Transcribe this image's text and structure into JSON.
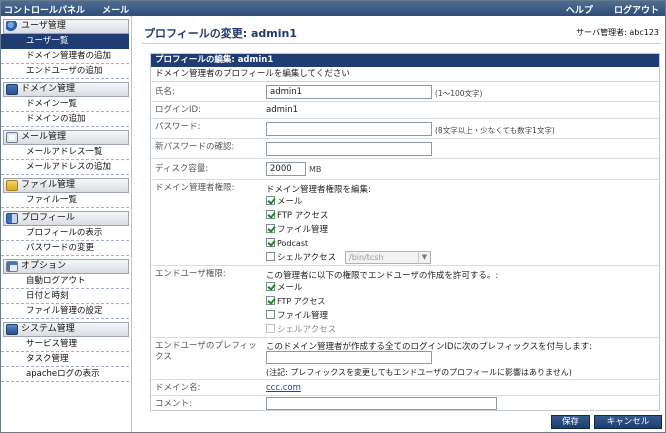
{
  "topbar": {
    "menu": [
      "コントロールパネル",
      "メール"
    ],
    "right": [
      "ヘルプ",
      "ログアウト"
    ]
  },
  "sidebar": {
    "sections": [
      {
        "title": "ユーザ管理",
        "icon": "users-icon",
        "items": [
          "ユーザ一覧",
          "ドメイン管理者の追加",
          "エンドユーザの追加"
        ]
      },
      {
        "title": "ドメイン管理",
        "icon": "network-icon",
        "items": [
          "ドメイン一覧",
          "ドメインの追加"
        ]
      },
      {
        "title": "メール管理",
        "icon": "mail-icon",
        "items": [
          "メールアドレス一覧",
          "メールアドレスの追加"
        ]
      },
      {
        "title": "ファイル管理",
        "icon": "folder-icon",
        "items": [
          "ファイル一覧"
        ]
      },
      {
        "title": "プロフィール",
        "icon": "profile-icon",
        "items": [
          "プロフィールの表示",
          "パスワードの変更"
        ]
      },
      {
        "title": "オプション",
        "icon": "options-icon",
        "items": [
          "自動ログアウト",
          "日付と時刻",
          "ファイル管理の設定"
        ]
      },
      {
        "title": "システム管理",
        "icon": "system-icon",
        "items": [
          "サービス管理",
          "タスク管理",
          "apacheログの表示"
        ]
      }
    ],
    "selected": "ユーザ一覧"
  },
  "header": {
    "title": "プロフィールの変更: admin1",
    "admin_label": "サーバ管理者: abc123"
  },
  "panel": {
    "title": "プロフィールの編集: admin1",
    "description": "ドメイン管理者のプロフィールを編集してください",
    "fields": {
      "name": {
        "label": "氏名:",
        "value": "admin1",
        "note": "(1〜100文字)"
      },
      "login": {
        "label": "ログインID:",
        "value": "admin1"
      },
      "password": {
        "label": "パスワード:",
        "value": "",
        "note": "(8文字以上・少なくても数字1文字)"
      },
      "password_confirm": {
        "label": "新パスワードの確認:",
        "value": ""
      },
      "disk": {
        "label": "ディスク容量:",
        "value": "2000",
        "unit": "MB"
      },
      "domain_perm": {
        "label": "ドメイン管理者権限:",
        "intro": "ドメイン管理者権限を編集:",
        "options": [
          {
            "label": "メール",
            "checked": true
          },
          {
            "label": "FTP アクセス",
            "checked": true
          },
          {
            "label": "ファイル管理",
            "checked": true
          },
          {
            "label": "Podcast",
            "checked": true
          },
          {
            "label": "シェルアクセス",
            "checked": false
          }
        ],
        "shell_select": "/bin/tcsh"
      },
      "enduser_perm": {
        "label": "エンドユーザ権限:",
        "intro": "この管理者に以下の権限でエンドユーザの作成を許可する。:",
        "options": [
          {
            "label": "メール",
            "checked": true
          },
          {
            "label": "FTP アクセス",
            "checked": true
          },
          {
            "label": "ファイル管理",
            "checked": false
          },
          {
            "label": "シェルアクセス",
            "checked": false
          }
        ]
      },
      "prefix": {
        "label": "エンドユーザのプレフィックス",
        "intro": "このドメイン管理者が作成する全てのログインIDに次のプレフィックスを付与します:",
        "value": "",
        "note": "(注記: プレフィックスを変更してもエンドユーザのプロフィールに影響はありません)"
      },
      "domain": {
        "label": "ドメイン名:",
        "value": "ccc.com"
      },
      "comment": {
        "label": "コメント:",
        "value": ""
      }
    }
  },
  "buttons": {
    "save": "保存",
    "cancel": "キャンセル"
  },
  "colors": {
    "topbar": "#3b5a86",
    "nav_selected": "#1f3d73",
    "panel_header": "#1f3d73",
    "check": "#1a8c1a"
  }
}
